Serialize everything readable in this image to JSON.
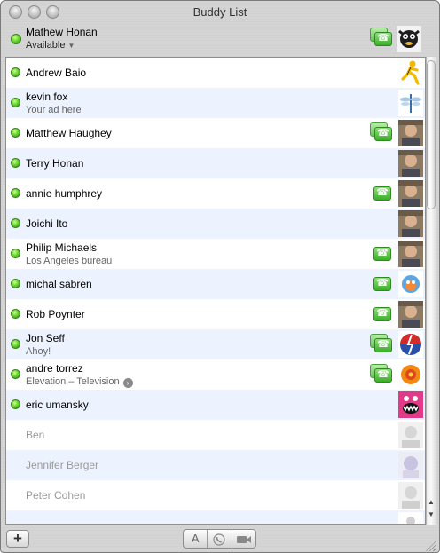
{
  "window": {
    "title": "Buddy List"
  },
  "me": {
    "name": "Mathew Honan",
    "status": "Available"
  },
  "buddies": [
    {
      "name": "Andrew Baio",
      "subtitle": "",
      "online": true,
      "phone": "none",
      "avatar": "aim-runner"
    },
    {
      "name": "kevin fox",
      "subtitle": "Your ad here",
      "online": true,
      "phone": "none",
      "avatar": "dragonfly"
    },
    {
      "name": "Matthew Haughey",
      "subtitle": "",
      "online": true,
      "phone": "multi",
      "avatar": "photo"
    },
    {
      "name": "Terry Honan",
      "subtitle": "",
      "online": true,
      "phone": "none",
      "avatar": "photo"
    },
    {
      "name": "annie humphrey",
      "subtitle": "",
      "online": true,
      "phone": "single",
      "avatar": "photo"
    },
    {
      "name": "Joichi Ito",
      "subtitle": "",
      "online": true,
      "phone": "none",
      "avatar": "photo"
    },
    {
      "name": "Philip Michaels",
      "subtitle": "Los Angeles bureau",
      "online": true,
      "phone": "single",
      "avatar": "photo"
    },
    {
      "name": "michal sabren",
      "subtitle": "",
      "online": true,
      "phone": "single",
      "avatar": "cartoon"
    },
    {
      "name": "Rob Poynter",
      "subtitle": "",
      "online": true,
      "phone": "single",
      "avatar": "photo"
    },
    {
      "name": "Jon Seff",
      "subtitle": "Ahoy!",
      "online": true,
      "phone": "multi",
      "avatar": "steal-your-face"
    },
    {
      "name": "andre torrez",
      "subtitle": "Elevation – Television",
      "online": true,
      "phone": "multi",
      "avatar": "orange-badge",
      "subtitle_link": true
    },
    {
      "name": "eric umansky",
      "subtitle": "",
      "online": true,
      "phone": "none",
      "avatar": "monster"
    },
    {
      "name": "Ben",
      "subtitle": "",
      "online": false,
      "phone": "none",
      "avatar": "faded-photo"
    },
    {
      "name": "Jennifer Berger",
      "subtitle": "",
      "online": false,
      "phone": "none",
      "avatar": "faded-cartoon"
    },
    {
      "name": "Peter Cohen",
      "subtitle": "",
      "online": false,
      "phone": "none",
      "avatar": "faded-photo"
    },
    {
      "name": "",
      "subtitle": "",
      "online": false,
      "phone": "none",
      "avatar": "faded-person"
    }
  ],
  "bottom": {
    "add_label": "+",
    "text_label": "A",
    "audio_icon": "phone-icon",
    "video_icon": "camera-icon"
  },
  "colors": {
    "online": "#5fd02a",
    "alt_row": "#edf3fe",
    "phone": "#3cae2a"
  }
}
